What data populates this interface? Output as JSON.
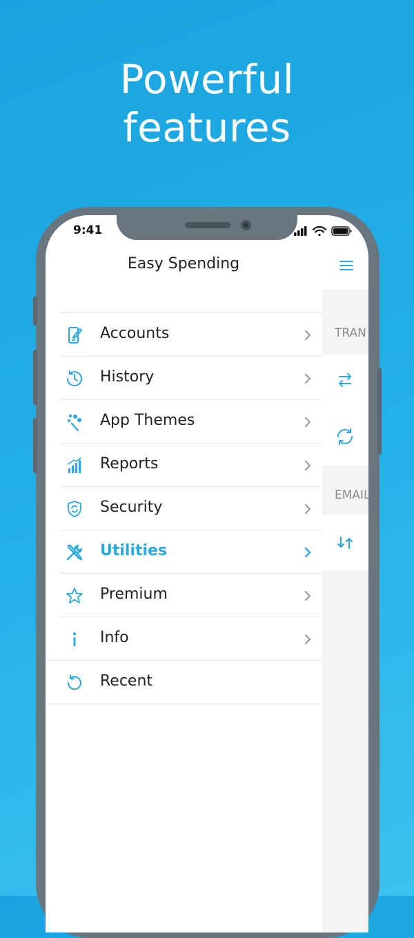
{
  "headline": {
    "line1": "Powerful",
    "line2": "features"
  },
  "status_bar": {
    "time": "9:41"
  },
  "app": {
    "title": "Easy Spending"
  },
  "right_panel": {
    "section1_label": "TRAN",
    "section2_label": "EMAIL",
    "icons": [
      "transfer-icon",
      "sync-icon",
      "sort-arrows-icon"
    ]
  },
  "menu": {
    "items": [
      {
        "label": "Accounts",
        "icon": "accounts-icon"
      },
      {
        "label": "History",
        "icon": "history-clock-icon"
      },
      {
        "label": "App Themes",
        "icon": "themes-icon"
      },
      {
        "label": "Reports",
        "icon": "reports-chart-icon"
      },
      {
        "label": "Security",
        "icon": "shield-icon"
      },
      {
        "label": "Utilities",
        "icon": "tools-icon",
        "active": true
      },
      {
        "label": "Premium",
        "icon": "star-icon"
      },
      {
        "label": "Info",
        "icon": "info-icon"
      }
    ],
    "recent_label": "Recent"
  },
  "colors": {
    "background": "#1aa3e0",
    "accent": "#2aa8e0",
    "phone_frame": "#6a767f"
  }
}
